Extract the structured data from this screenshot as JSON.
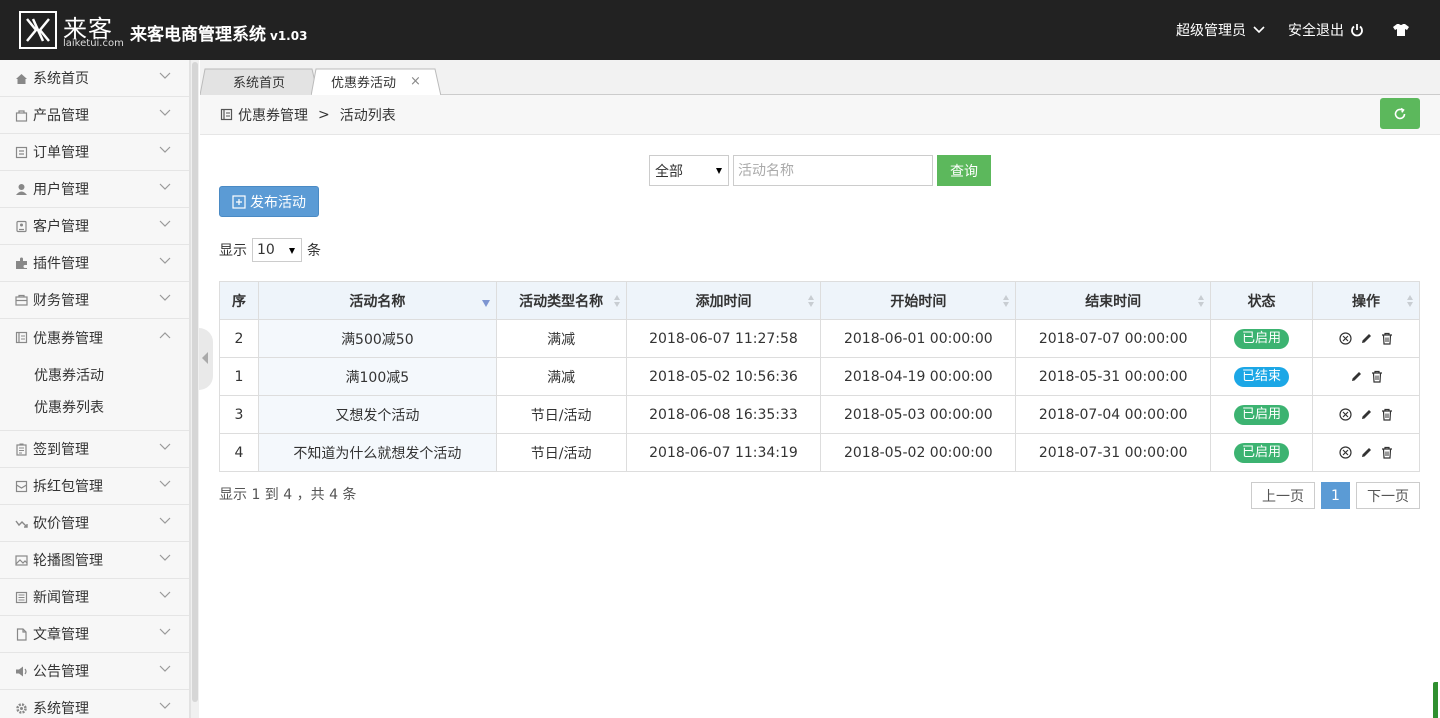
{
  "header": {
    "logo_cn": "来客",
    "logo_en": "laiketui.com",
    "title": "来客电商管理系统",
    "version": "v1.03",
    "user": "超级管理员",
    "logout": "安全退出"
  },
  "sidebar": {
    "items": [
      {
        "label": "系统首页",
        "icon": "home-icon"
      },
      {
        "label": "产品管理",
        "icon": "bag-icon"
      },
      {
        "label": "订单管理",
        "icon": "list-icon"
      },
      {
        "label": "用户管理",
        "icon": "user-icon"
      },
      {
        "label": "客户管理",
        "icon": "customer-icon"
      },
      {
        "label": "插件管理",
        "icon": "puzzle-icon"
      },
      {
        "label": "财务管理",
        "icon": "finance-icon"
      },
      {
        "label": "优惠券管理",
        "icon": "coupon-icon",
        "expanded": true
      }
    ],
    "sub_items": [
      "优惠券活动",
      "优惠券列表"
    ],
    "items_after": [
      {
        "label": "签到管理",
        "icon": "checkin-icon"
      },
      {
        "label": "拆红包管理",
        "icon": "redpacket-icon"
      },
      {
        "label": "砍价管理",
        "icon": "bargain-icon"
      },
      {
        "label": "轮播图管理",
        "icon": "image-icon"
      },
      {
        "label": "新闻管理",
        "icon": "news-icon"
      },
      {
        "label": "文章管理",
        "icon": "document-icon"
      },
      {
        "label": "公告管理",
        "icon": "speaker-icon"
      },
      {
        "label": "系统管理",
        "icon": "gear-icon"
      }
    ]
  },
  "tabs": [
    {
      "label": "系统首页",
      "active": false
    },
    {
      "label": "优惠券活动",
      "active": true,
      "close": "×"
    }
  ],
  "breadcrumb": {
    "parent": "优惠券管理",
    "sep": ">",
    "current": "活动列表"
  },
  "search": {
    "select_value": "全部",
    "placeholder": "活动名称",
    "button": "查询"
  },
  "publish_button": "发布活动",
  "pagesize": {
    "prefix": "显示",
    "value": "10",
    "suffix": "条"
  },
  "table": {
    "columns": [
      "序",
      "活动名称",
      "活动类型名称",
      "添加时间",
      "开始时间",
      "结束时间",
      "状态",
      "操作"
    ],
    "rows": [
      {
        "id": "2",
        "name": "满500减50",
        "type": "满减",
        "added": "2018-06-07 11:27:58",
        "start": "2018-06-01 00:00:00",
        "end": "2018-07-07 00:00:00",
        "status": "已启用",
        "state": "on"
      },
      {
        "id": "1",
        "name": "满100减5",
        "type": "满减",
        "added": "2018-05-02 10:56:36",
        "start": "2018-04-19 00:00:00",
        "end": "2018-05-31 00:00:00",
        "status": "已结束",
        "state": "end"
      },
      {
        "id": "3",
        "name": "又想发个活动",
        "type": "节日/活动",
        "added": "2018-06-08 16:35:33",
        "start": "2018-05-03 00:00:00",
        "end": "2018-07-04 00:00:00",
        "status": "已启用",
        "state": "on"
      },
      {
        "id": "4",
        "name": "不知道为什么就想发个活动",
        "type": "节日/活动",
        "added": "2018-06-07 11:34:19",
        "start": "2018-05-02 00:00:00",
        "end": "2018-07-31 00:00:00",
        "status": "已启用",
        "state": "on"
      }
    ]
  },
  "footer": {
    "info": "显示 1 到 4 ，共 4 条",
    "prev": "上一页",
    "current_page": "1",
    "next": "下一页"
  },
  "colors": {
    "topbar": "#222222",
    "primary": "#5b9bd5",
    "success": "#5cb85c",
    "badge_on": "#3cb371",
    "badge_end": "#1ca7e6"
  }
}
